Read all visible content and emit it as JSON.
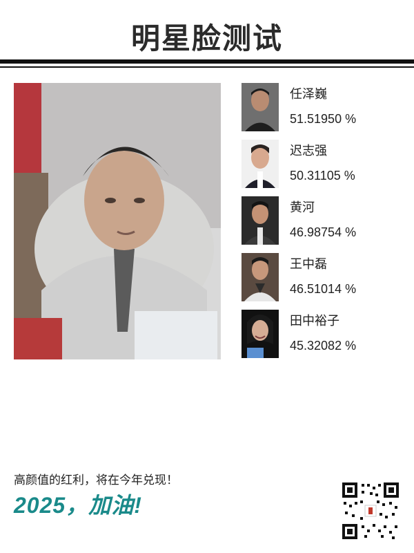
{
  "header": {
    "title": "明星脸测试"
  },
  "matches": [
    {
      "name": "任泽巍",
      "score": "51.51950 %"
    },
    {
      "name": "迟志强",
      "score": "50.31105 %"
    },
    {
      "name": "黄河",
      "score": "46.98754 %"
    },
    {
      "name": "王中磊",
      "score": "46.51014 %"
    },
    {
      "name": "田中裕子",
      "score": "45.32082 %"
    }
  ],
  "footer": {
    "tagline": "高颜值的红利，将在今年兑现！",
    "slogan": "2025，加油!"
  },
  "colors": {
    "accent": "#1a8a8a",
    "rule": "#111111"
  }
}
